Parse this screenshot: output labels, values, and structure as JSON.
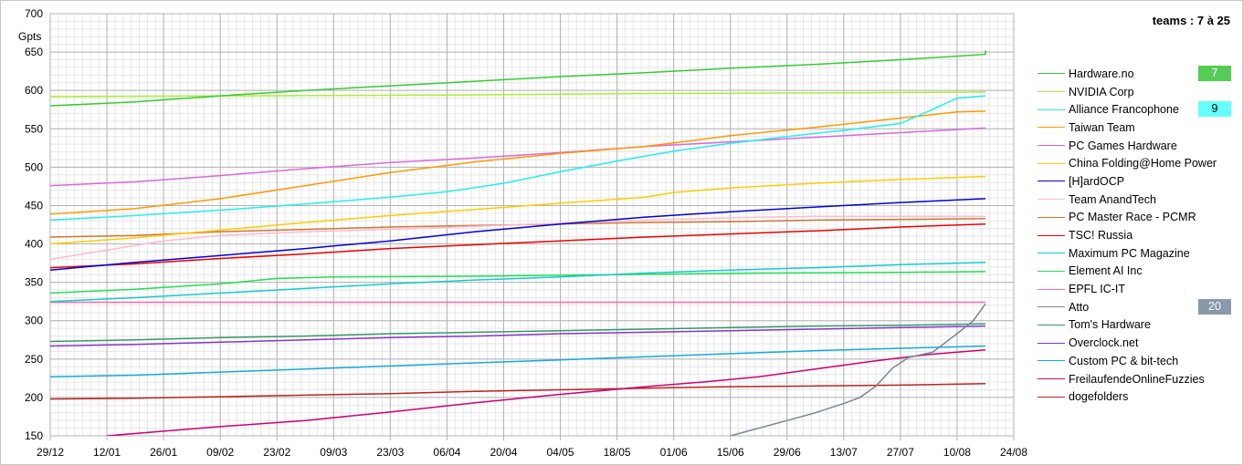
{
  "header": {
    "teams_range": "teams : 7 à 25"
  },
  "chart_data": {
    "type": "line",
    "ylabel": "Gpts",
    "ylim": [
      150,
      700
    ],
    "yticks": [
      150,
      200,
      250,
      300,
      350,
      400,
      450,
      500,
      550,
      600,
      650,
      700
    ],
    "xticks": [
      "29/12",
      "12/01",
      "26/01",
      "09/02",
      "23/02",
      "09/03",
      "23/03",
      "06/04",
      "20/04",
      "04/05",
      "18/05",
      "01/06",
      "15/06",
      "29/06",
      "13/07",
      "27/07",
      "10/08",
      "24/08"
    ],
    "x_domain_days": [
      0,
      238
    ],
    "grid": true,
    "legend_position": "right",
    "series": [
      {
        "name": "Hardware.no",
        "color": "#33cc33",
        "rank": "7",
        "badge_color": "#55cc55",
        "points": [
          [
            0,
            580
          ],
          [
            21,
            585
          ],
          [
            42,
            593
          ],
          [
            63,
            600
          ],
          [
            84,
            606
          ],
          [
            105,
            612
          ],
          [
            126,
            618
          ],
          [
            147,
            623
          ],
          [
            168,
            629
          ],
          [
            189,
            634
          ],
          [
            210,
            640
          ],
          [
            231,
            647
          ],
          [
            231,
            652
          ],
          [
            231,
            652
          ]
        ]
      },
      {
        "name": "NVIDIA Corp",
        "color": "#aaee33",
        "rank": "",
        "badge_color": "",
        "points": [
          [
            0,
            592
          ],
          [
            50,
            593
          ],
          [
            100,
            594
          ],
          [
            150,
            596
          ],
          [
            200,
            597
          ],
          [
            231,
            598
          ]
        ]
      },
      {
        "name": "Alliance Francophone",
        "color": "#22eeee",
        "rank": "9",
        "badge_color": "#66ffff",
        "points": [
          [
            0,
            431
          ],
          [
            21,
            437
          ],
          [
            42,
            444
          ],
          [
            63,
            452
          ],
          [
            84,
            461
          ],
          [
            98,
            468
          ],
          [
            112,
            479
          ],
          [
            126,
            494
          ],
          [
            140,
            508
          ],
          [
            154,
            521
          ],
          [
            168,
            531
          ],
          [
            182,
            540
          ],
          [
            196,
            548
          ],
          [
            210,
            557
          ],
          [
            217,
            573
          ],
          [
            224,
            590
          ],
          [
            231,
            593
          ]
        ]
      },
      {
        "name": "Taiwan Team",
        "color": "#ff9900",
        "rank": "",
        "badge_color": "",
        "points": [
          [
            0,
            439
          ],
          [
            21,
            446
          ],
          [
            42,
            459
          ],
          [
            63,
            476
          ],
          [
            84,
            493
          ],
          [
            105,
            507
          ],
          [
            126,
            518
          ],
          [
            147,
            527
          ],
          [
            168,
            541
          ],
          [
            189,
            552
          ],
          [
            210,
            564
          ],
          [
            224,
            572
          ],
          [
            231,
            573
          ]
        ]
      },
      {
        "name": "PC Games Hardware",
        "color": "#dd66dd",
        "rank": "",
        "badge_color": "",
        "points": [
          [
            0,
            476
          ],
          [
            21,
            481
          ],
          [
            42,
            489
          ],
          [
            63,
            498
          ],
          [
            84,
            506
          ],
          [
            105,
            512
          ],
          [
            126,
            519
          ],
          [
            147,
            527
          ],
          [
            168,
            533
          ],
          [
            189,
            539
          ],
          [
            210,
            545
          ],
          [
            231,
            551
          ]
        ]
      },
      {
        "name": "China Folding@Home Power",
        "color": "#ffcc00",
        "rank": "",
        "badge_color": "",
        "points": [
          [
            0,
            400
          ],
          [
            21,
            408
          ],
          [
            42,
            418
          ],
          [
            63,
            428
          ],
          [
            84,
            437
          ],
          [
            105,
            445
          ],
          [
            126,
            453
          ],
          [
            147,
            461
          ],
          [
            154,
            467
          ],
          [
            168,
            473
          ],
          [
            189,
            479
          ],
          [
            210,
            484
          ],
          [
            231,
            488
          ]
        ]
      },
      {
        "name": "[H]ardOCP",
        "color": "#0000dd",
        "rank": "",
        "badge_color": "",
        "points": [
          [
            0,
            366
          ],
          [
            21,
            376
          ],
          [
            42,
            385
          ],
          [
            63,
            394
          ],
          [
            84,
            404
          ],
          [
            105,
            416
          ],
          [
            126,
            426
          ],
          [
            147,
            435
          ],
          [
            168,
            442
          ],
          [
            189,
            448
          ],
          [
            210,
            454
          ],
          [
            231,
            459
          ]
        ]
      },
      {
        "name": "Team AnandTech",
        "color": "#ffbbcc",
        "rank": "",
        "badge_color": "",
        "points": [
          [
            0,
            380
          ],
          [
            14,
            392
          ],
          [
            28,
            404
          ],
          [
            42,
            411
          ],
          [
            63,
            416
          ],
          [
            84,
            419
          ],
          [
            105,
            423
          ],
          [
            126,
            427
          ],
          [
            147,
            431
          ],
          [
            168,
            434
          ],
          [
            189,
            436
          ],
          [
            210,
            436
          ],
          [
            231,
            436
          ]
        ]
      },
      {
        "name": "PC Master Race - PCMR",
        "color": "#cc7733",
        "rank": "",
        "badge_color": "",
        "points": [
          [
            0,
            409
          ],
          [
            21,
            411
          ],
          [
            42,
            416
          ],
          [
            63,
            419
          ],
          [
            84,
            422
          ],
          [
            105,
            424
          ],
          [
            126,
            426
          ],
          [
            147,
            428
          ],
          [
            168,
            429
          ],
          [
            189,
            431
          ],
          [
            210,
            432
          ],
          [
            231,
            433
          ]
        ]
      },
      {
        "name": "TSC! Russia",
        "color": "#ee0000",
        "rank": "",
        "badge_color": "",
        "points": [
          [
            0,
            369
          ],
          [
            21,
            374
          ],
          [
            42,
            381
          ],
          [
            63,
            387
          ],
          [
            84,
            394
          ],
          [
            105,
            399
          ],
          [
            126,
            404
          ],
          [
            147,
            409
          ],
          [
            168,
            413
          ],
          [
            189,
            417
          ],
          [
            210,
            422
          ],
          [
            231,
            426
          ]
        ]
      },
      {
        "name": "Maximum PC Magazine",
        "color": "#11cccc",
        "rank": "",
        "badge_color": "",
        "points": [
          [
            0,
            325
          ],
          [
            21,
            330
          ],
          [
            42,
            336
          ],
          [
            63,
            342
          ],
          [
            84,
            348
          ],
          [
            105,
            353
          ],
          [
            126,
            357
          ],
          [
            147,
            362
          ],
          [
            168,
            366
          ],
          [
            189,
            369
          ],
          [
            210,
            373
          ],
          [
            231,
            376
          ]
        ]
      },
      {
        "name": "Element AI Inc",
        "color": "#22dd55",
        "rank": "",
        "badge_color": "",
        "points": [
          [
            0,
            336
          ],
          [
            21,
            341
          ],
          [
            42,
            348
          ],
          [
            56,
            355
          ],
          [
            70,
            357
          ],
          [
            105,
            358
          ],
          [
            140,
            360
          ],
          [
            175,
            362
          ],
          [
            210,
            363
          ],
          [
            231,
            364
          ]
        ]
      },
      {
        "name": "EPFL IC-IT",
        "color": "#ff66aa",
        "rank": "",
        "badge_color": "",
        "points": [
          [
            0,
            324
          ],
          [
            231,
            324
          ]
        ]
      },
      {
        "name": "Atto",
        "color": "#778899",
        "rank": "20",
        "badge_color": "#8899aa",
        "points": [
          [
            168,
            150
          ],
          [
            175,
            160
          ],
          [
            182,
            170
          ],
          [
            189,
            180
          ],
          [
            196,
            192
          ],
          [
            200,
            200
          ],
          [
            204,
            215
          ],
          [
            208,
            238
          ],
          [
            212,
            252
          ],
          [
            218,
            259
          ],
          [
            224,
            283
          ],
          [
            228,
            300
          ],
          [
            231,
            322
          ]
        ]
      },
      {
        "name": "Tom's Hardware",
        "color": "#339966",
        "rank": "",
        "badge_color": "",
        "points": [
          [
            0,
            273
          ],
          [
            21,
            275
          ],
          [
            42,
            278
          ],
          [
            63,
            280
          ],
          [
            84,
            283
          ],
          [
            105,
            285
          ],
          [
            126,
            287
          ],
          [
            147,
            289
          ],
          [
            168,
            291
          ],
          [
            189,
            293
          ],
          [
            210,
            294
          ],
          [
            231,
            296
          ]
        ]
      },
      {
        "name": "Overclock.net",
        "color": "#8833cc",
        "rank": "",
        "badge_color": "",
        "points": [
          [
            0,
            267
          ],
          [
            21,
            269
          ],
          [
            42,
            272
          ],
          [
            63,
            275
          ],
          [
            84,
            278
          ],
          [
            105,
            280
          ],
          [
            126,
            283
          ],
          [
            147,
            285
          ],
          [
            168,
            287
          ],
          [
            189,
            289
          ],
          [
            210,
            291
          ],
          [
            231,
            293
          ]
        ]
      },
      {
        "name": "Custom PC & bit-tech",
        "color": "#11aadd",
        "rank": "",
        "badge_color": "",
        "points": [
          [
            0,
            227
          ],
          [
            21,
            229
          ],
          [
            42,
            233
          ],
          [
            63,
            237
          ],
          [
            84,
            241
          ],
          [
            105,
            245
          ],
          [
            126,
            249
          ],
          [
            147,
            253
          ],
          [
            168,
            257
          ],
          [
            189,
            261
          ],
          [
            210,
            264
          ],
          [
            231,
            267
          ]
        ]
      },
      {
        "name": "FreilaufendeOnlineFuzzies",
        "color": "#cc0077",
        "rank": "",
        "badge_color": "",
        "points": [
          [
            14,
            150
          ],
          [
            28,
            156
          ],
          [
            42,
            162
          ],
          [
            63,
            170
          ],
          [
            84,
            181
          ],
          [
            105,
            193
          ],
          [
            126,
            204
          ],
          [
            147,
            214
          ],
          [
            161,
            220
          ],
          [
            175,
            227
          ],
          [
            189,
            237
          ],
          [
            203,
            247
          ],
          [
            217,
            256
          ],
          [
            231,
            262
          ]
        ]
      },
      {
        "name": "dogefolders",
        "color": "#bb2222",
        "rank": "",
        "badge_color": "",
        "points": [
          [
            0,
            198
          ],
          [
            21,
            199
          ],
          [
            42,
            201
          ],
          [
            63,
            203
          ],
          [
            84,
            205
          ],
          [
            105,
            208
          ],
          [
            126,
            210
          ],
          [
            147,
            212
          ],
          [
            168,
            214
          ],
          [
            189,
            215
          ],
          [
            210,
            216
          ],
          [
            231,
            218
          ]
        ]
      }
    ]
  }
}
